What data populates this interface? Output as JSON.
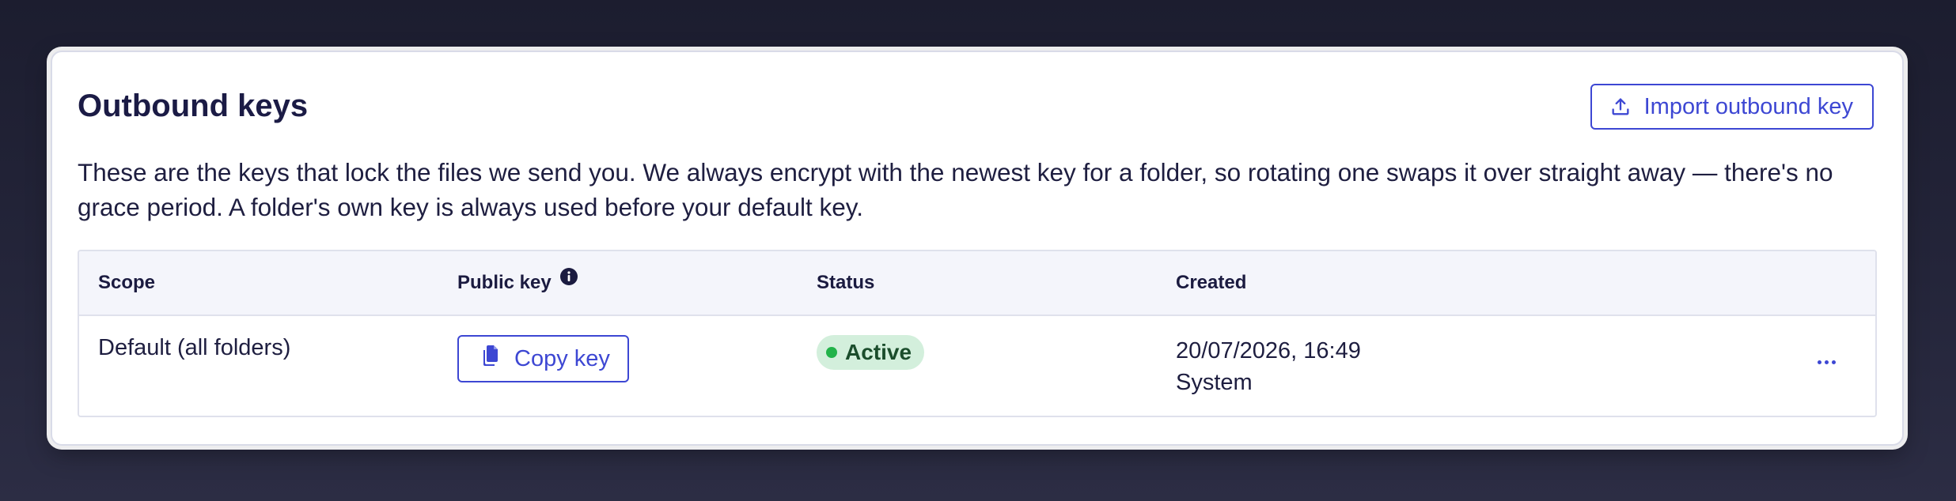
{
  "panel": {
    "title": "Outbound keys",
    "import_button": {
      "label": "Import outbound key",
      "icon": "upload-icon"
    },
    "description": "These are the keys that lock the files we send you. We always encrypt with the newest key for a folder, so rotating one swaps it over straight away — there's no grace period. A folder's own key is always used before your default key."
  },
  "table": {
    "columns": [
      {
        "key": "scope",
        "label": "Scope"
      },
      {
        "key": "public_key",
        "label": "Public key",
        "icon": "info-icon"
      },
      {
        "key": "status",
        "label": "Status"
      },
      {
        "key": "created",
        "label": "Created"
      }
    ],
    "rows": [
      {
        "scope": "Default (all folders)",
        "public_key": {
          "button_label": "Copy key",
          "icon": "copy-icon"
        },
        "status": {
          "label": "Active",
          "color": "#22b34a"
        },
        "created": {
          "date": "20/07/2026, 16:49",
          "by": "System"
        },
        "actions_icon": "more-horizontal-icon"
      }
    ]
  },
  "colors": {
    "accent": "#3d47d3",
    "title": "#1b1b45",
    "status_active_bg": "#d3efdc",
    "status_active_dot": "#22b34a",
    "table_header_bg": "#f4f5fb"
  }
}
